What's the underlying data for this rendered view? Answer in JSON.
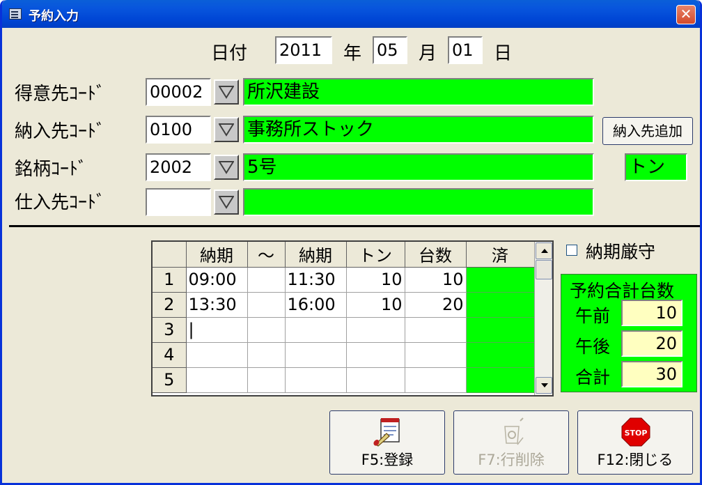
{
  "window": {
    "title": "予約入力",
    "close_glyph": "✕"
  },
  "date": {
    "label": "日付",
    "year": "2011",
    "year_suffix": "年",
    "month": "05",
    "month_suffix": "月",
    "day": "01",
    "day_suffix": "日"
  },
  "rows": [
    {
      "label": "得意先ｺｰﾄﾞ",
      "code": "00002",
      "name": "所沢建設"
    },
    {
      "label": "納入先ｺｰﾄﾞ",
      "code": "0100",
      "name": "事務所ストック"
    },
    {
      "label": "銘柄ｺｰﾄﾞ",
      "code": "2002",
      "name": "5号"
    },
    {
      "label": "仕入先ｺｰﾄﾞ",
      "code": "",
      "name": ""
    }
  ],
  "add_destination_label": "納入先追加",
  "unit_label": "トン",
  "grid": {
    "headers": [
      "納期",
      "〜",
      "納期",
      "トン",
      "台数",
      "済"
    ],
    "rows": [
      {
        "n": "1",
        "start": "09:00",
        "tilde": "",
        "end": "11:30",
        "ton": "10",
        "count": "10",
        "done": ""
      },
      {
        "n": "2",
        "start": "13:30",
        "tilde": "",
        "end": "16:00",
        "ton": "10",
        "count": "20",
        "done": ""
      },
      {
        "n": "3",
        "start": "|",
        "tilde": "",
        "end": "",
        "ton": "",
        "count": "",
        "done": ""
      },
      {
        "n": "4",
        "start": "",
        "tilde": "",
        "end": "",
        "ton": "",
        "count": "",
        "done": ""
      },
      {
        "n": "5",
        "start": "",
        "tilde": "",
        "end": "",
        "ton": "",
        "count": "",
        "done": ""
      }
    ]
  },
  "deadline_checkbox": {
    "label": "納期厳守",
    "checked": false
  },
  "summary": {
    "title": "予約合計台数",
    "am_label": "午前",
    "am_value": "10",
    "pm_label": "午後",
    "pm_value": "20",
    "total_label": "合計",
    "total_value": "30"
  },
  "buttons": {
    "register": "F5:登録",
    "delete_row": "F7:行削除",
    "close": "F12:閉じる",
    "stop_text": "STOP"
  },
  "colors": {
    "accent_green": "#00ff00",
    "titlebar": "#0054e3",
    "sum_field": "#ffffc0"
  }
}
